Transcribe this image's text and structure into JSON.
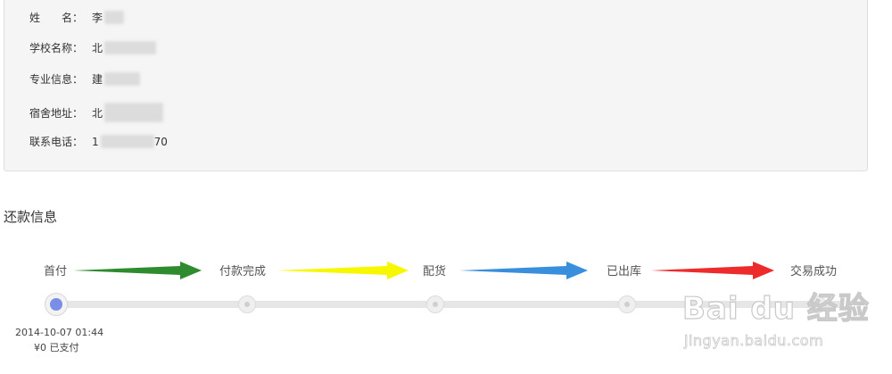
{
  "receiver": {
    "name_label": "姓　　名：",
    "name_value": "李",
    "school_label": "学校名称：",
    "school_value": "北",
    "major_label": "专业信息：",
    "major_value": "建",
    "dorm_label": "宿舍地址：",
    "dorm_value": "北",
    "phone_label": "联系电话：",
    "phone_prefix": "1",
    "phone_suffix": "70"
  },
  "repayment": {
    "title": "还款信息",
    "steps": [
      {
        "label": "首付"
      },
      {
        "label": "付款完成"
      },
      {
        "label": "配货"
      },
      {
        "label": "已出库"
      },
      {
        "label": "交易成功"
      }
    ],
    "arrow_colors": [
      "#2e8b2e",
      "#f7f700",
      "#3a8fdd",
      "#ee2b2b"
    ],
    "active_step": 0,
    "first_node_time": "2014-10-07 01:44",
    "first_node_status": "¥0 已支付"
  },
  "watermark": {
    "brand": "Bai du 经验",
    "url": "jingyan.baidu.com"
  }
}
